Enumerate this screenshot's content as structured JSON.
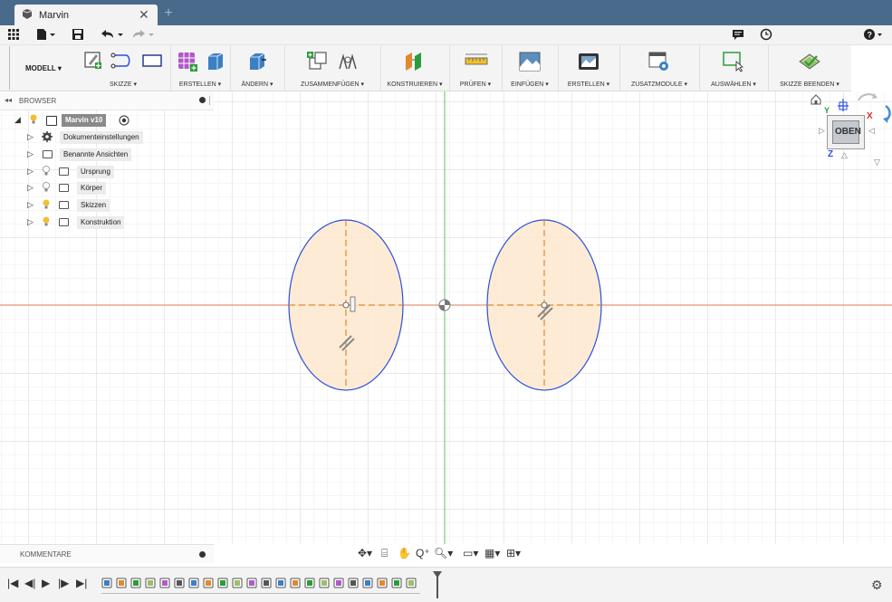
{
  "window": {
    "tab_title": "Marvin",
    "tab_close": "✕",
    "new_tab": "+"
  },
  "quick_access": {
    "grid_icon": "app-grid-icon",
    "file_icon": "file-icon",
    "save_icon": "save-icon",
    "undo_icon": "undo-icon",
    "redo_icon": "redo-icon",
    "notifications_icon": "chat-icon",
    "history_icon": "clock-icon",
    "help_icon": "help-icon"
  },
  "ribbon": {
    "workspace": "MODELL ▾",
    "groups": [
      {
        "label": "SKIZZE ▾"
      },
      {
        "label": "ERSTELLEN ▾"
      },
      {
        "label": "ÄNDERN ▾"
      },
      {
        "label": "ZUSAMMENFÜGEN ▾"
      },
      {
        "label": "KONSTRUIEREN ▾"
      },
      {
        "label": "PRÜFEN ▾"
      },
      {
        "label": "EINFÜGEN ▾"
      },
      {
        "label": "ERSTELLEN ▾"
      },
      {
        "label": "ZUSATZMODULE ▾"
      },
      {
        "label": "AUSWÄHLEN ▾"
      },
      {
        "label": "SKIZZE BEENDEN ▾"
      }
    ]
  },
  "browser": {
    "title": "BROWSER",
    "root": "Marvin v10",
    "items": [
      {
        "label": "Dokumenteinstellungen"
      },
      {
        "label": "Benannte Ansichten"
      },
      {
        "label": "Ursprung"
      },
      {
        "label": "Körper"
      },
      {
        "label": "Skizzen"
      },
      {
        "label": "Konstruktion"
      }
    ]
  },
  "viewcube": {
    "face": "OBEN",
    "axis_x": "X",
    "axis_y": "Y",
    "axis_z": "Z"
  },
  "comments": {
    "title": "KOMMENTARE"
  },
  "timeline": {
    "feature_count": 22
  },
  "colors": {
    "titlebar": "#4a6a8c",
    "sketch_curve": "#2a4fd8",
    "profile_fill": "#fde7cf",
    "construction_line": "#e08a2e",
    "x_axis": "#e07a5a",
    "y_axis": "#5cc35c"
  }
}
